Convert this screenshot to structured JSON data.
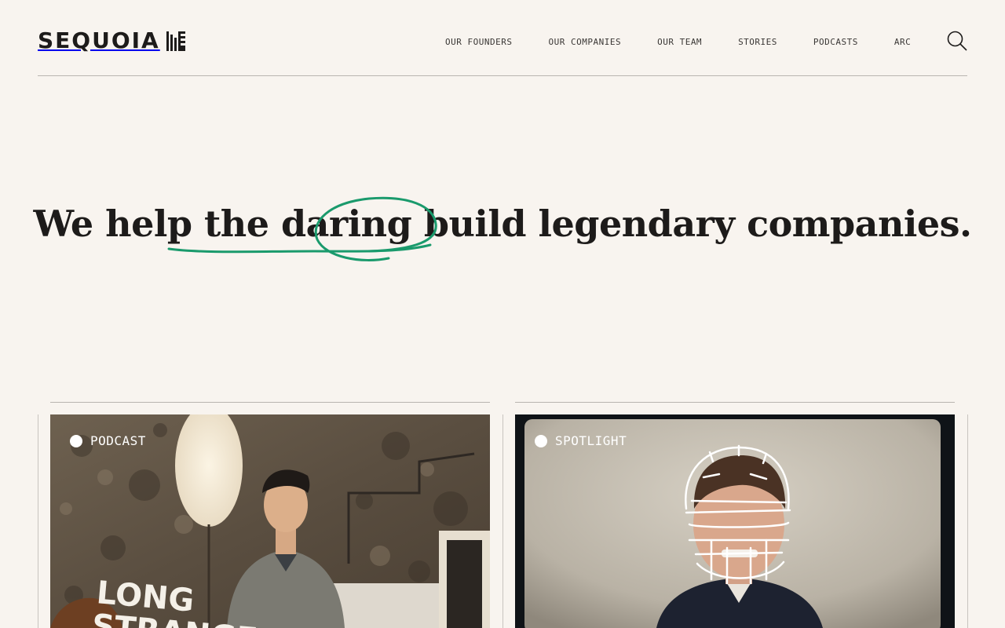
{
  "brand": {
    "name": "SEQUOIA"
  },
  "nav": {
    "items": [
      "OUR FOUNDERS",
      "OUR COMPANIES",
      "OUR TEAM",
      "STORIES",
      "PODCASTS",
      "ARC"
    ],
    "search_icon": "search-icon"
  },
  "hero": {
    "part1": "We",
    "part2": "help the",
    "highlight": "daring",
    "part3": "build legendary companies.",
    "accent": "#1a9a6c"
  },
  "cards": [
    {
      "tag": "PODCAST",
      "art_text": "LONG STRANGE"
    },
    {
      "tag": "SPOTLIGHT"
    }
  ],
  "colors": {
    "background": "#f8f4ef",
    "text": "#1d1b1a",
    "accent": "#1a9a6c"
  }
}
